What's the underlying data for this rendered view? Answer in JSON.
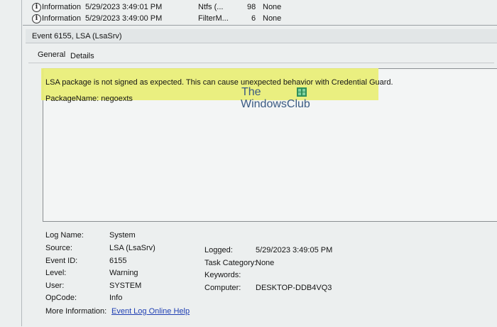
{
  "event_list": [
    {
      "level": "Information",
      "datetime": "5/29/2023 3:49:01 PM",
      "source": "Ntfs (...",
      "event_id": "98",
      "task_category": "None"
    },
    {
      "level": "Information",
      "datetime": "5/29/2023 3:49:00 PM",
      "source": "FilterM...",
      "event_id": "6",
      "task_category": "None"
    }
  ],
  "header": {
    "title": "Event 6155, LSA (LsaSrv)"
  },
  "tabs": [
    {
      "label": "General"
    },
    {
      "label": "Details"
    }
  ],
  "description": {
    "message": "LSA package is not signed as expected. This can cause unexpected behavior with Credential Guard.",
    "package": "PackageName: negoexts"
  },
  "watermark": {
    "line1": "The",
    "line2": "WindowsClub"
  },
  "details": {
    "log_name": {
      "label": "Log Name:",
      "value": "System"
    },
    "source": {
      "label": "Source:",
      "value": "LSA (LsaSrv)"
    },
    "logged": {
      "label": "Logged:",
      "value": "5/29/2023 3:49:05 PM"
    },
    "event_id": {
      "label": "Event ID:",
      "value": "6155"
    },
    "task_category": {
      "label": "Task Category:",
      "value": "None"
    },
    "level": {
      "label": "Level:",
      "value": "Warning"
    },
    "keywords": {
      "label": "Keywords:",
      "value": ""
    },
    "user": {
      "label": "User:",
      "value": "SYSTEM"
    },
    "computer": {
      "label": "Computer:",
      "value": "DESKTOP-DDB4VQ3"
    },
    "opcode": {
      "label": "OpCode:",
      "value": "Info"
    },
    "more_info": {
      "label": "More Information:",
      "link": "Event Log Online Help"
    }
  },
  "colors": {
    "highlight": "#e9ee75",
    "link": "#1f3fb3",
    "watermark": "#3a5a82"
  }
}
